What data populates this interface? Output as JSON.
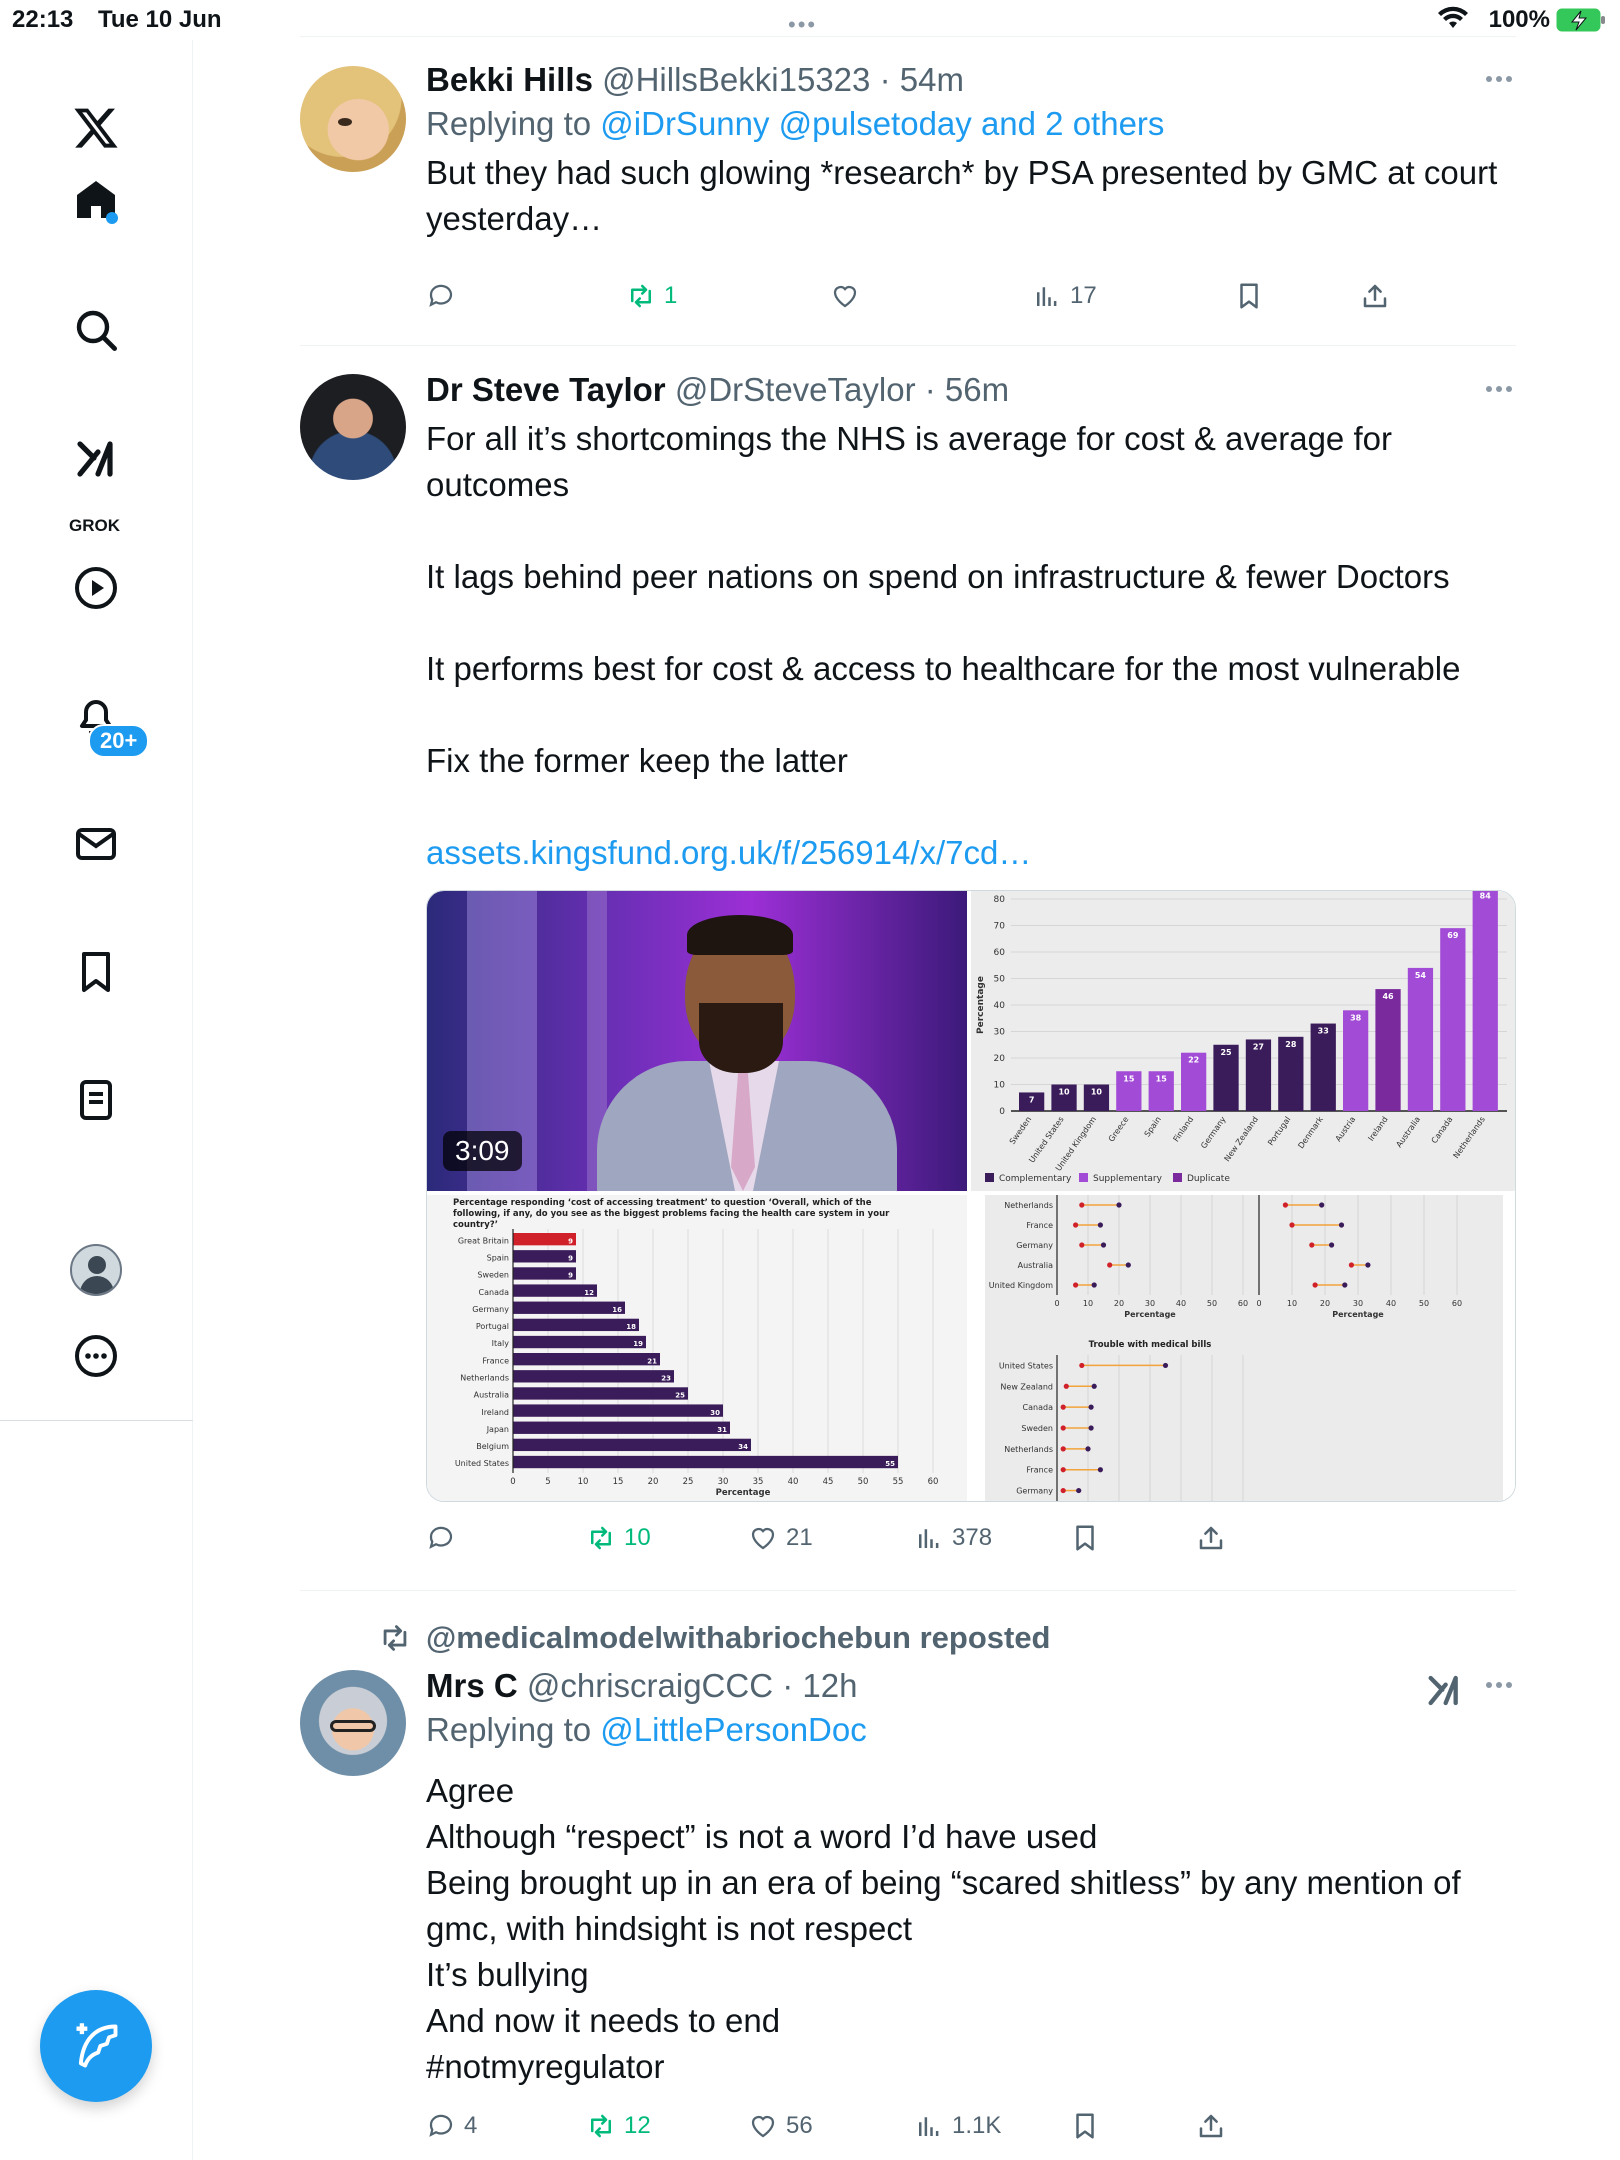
{
  "status_bar": {
    "time": "22:13",
    "date": "Tue 10 Jun",
    "battery": "100%"
  },
  "nav": {
    "notifications_badge": "20+",
    "grok_label": "GROK",
    "items": [
      "x-logo-icon",
      "home-icon",
      "search-icon",
      "grok-icon",
      "video-icon",
      "notifications-icon",
      "messages-icon",
      "bookmarks-icon",
      "lists-icon",
      "profile-icon",
      "more-icon"
    ]
  },
  "tweets": [
    {
      "name": "Bekki Hills",
      "handle": "@HillsBekki15323",
      "time": "54m",
      "reply_prefix": "Replying to",
      "reply_to": "@iDrSunny @pulsetoday and 2 others",
      "text": "But they had such glowing *research* by PSA presented by GMC at court yesterday…",
      "actions": {
        "replies": "",
        "retweets": "1",
        "likes": "",
        "views": "17"
      }
    },
    {
      "name": "Dr Steve Taylor",
      "handle": "@DrSteveTaylor",
      "time": "56m",
      "paragraphs": [
        "For all it’s shortcomings the NHS is average for cost & average for outcomes",
        "It lags behind peer nations on spend on infrastructure & fewer Doctors",
        "It performs best for cost & access to healthcare for the most vulnerable",
        "Fix the former keep the latter"
      ],
      "link": "assets.kingsfund.org.uk/f/256914/x/7cd…",
      "media": {
        "video_duration": "3:09"
      },
      "actions": {
        "replies": "",
        "retweets": "10",
        "likes": "21",
        "views": "378"
      }
    },
    {
      "repost_by": "@medicalmodelwithabriochebun reposted",
      "name": "Mrs C",
      "handle": "@chriscraigCCC",
      "time": "12h",
      "reply_prefix": "Replying to",
      "reply_to": "@LittlePersonDoc",
      "lines": [
        "Agree",
        "Although “respect” is not a word I’d have used",
        "Being brought up in an era of being “scared shitless” by any mention of gmc, with hindsight is not respect",
        "It’s bullying",
        "And now it needs to end"
      ],
      "hashtag": "#notmyregulator",
      "actions": {
        "replies": "4",
        "retweets": "12",
        "likes": "56",
        "views": "1.1K"
      }
    }
  ],
  "chart_data": [
    {
      "type": "bar",
      "ylabel": "Percentage",
      "ylim": [
        0,
        80
      ],
      "categories": [
        "Sweden",
        "United States",
        "United Kingdom",
        "Greece",
        "Spain",
        "Finland",
        "Germany",
        "New Zealand",
        "Portugal",
        "Denmark",
        "Austria",
        "Ireland",
        "Australia",
        "Canada",
        "Netherlands"
      ],
      "values": [
        7,
        10,
        10,
        15,
        15,
        22,
        25,
        27,
        28,
        33,
        38,
        46,
        54,
        69,
        84
      ],
      "kinds": [
        "Complementary",
        "Complementary",
        "Complementary",
        "Supplementary",
        "Supplementary",
        "Supplementary",
        "Complementary",
        "Complementary",
        "Complementary",
        "Complementary",
        "Supplementary",
        "Duplicate",
        "Supplementary",
        "Supplementary",
        "Supplementary"
      ],
      "legend": [
        "Complementary",
        "Supplementary",
        "Duplicate"
      ],
      "colors": {
        "Complementary": "#3b1c5a",
        "Supplementary": "#a24bd6",
        "Duplicate": "#7b2a9e"
      }
    },
    {
      "type": "bar",
      "orientation": "horizontal",
      "title": "Percentage responding ‘cost of accessing treatment’ to question ‘Overall, which of the following, if any, do you see as the biggest problems facing the health care system in your country?’",
      "xlabel": "Percentage",
      "xlim": [
        0,
        60
      ],
      "xticks": [
        0,
        5,
        10,
        15,
        20,
        25,
        30,
        35,
        40,
        45,
        50,
        55,
        60
      ],
      "categories": [
        "Great Britain",
        "Spain",
        "Sweden",
        "Canada",
        "Germany",
        "Portugal",
        "Italy",
        "France",
        "Netherlands",
        "Australia",
        "Ireland",
        "Japan",
        "Belgium",
        "United States"
      ],
      "values": [
        9,
        9,
        9,
        12,
        16,
        18,
        19,
        21,
        23,
        25,
        30,
        31,
        34,
        55
      ],
      "highlight": "Great Britain",
      "colors": {
        "highlight": "#d0202a",
        "default": "#3b1c5a"
      }
    },
    {
      "type": "scatter",
      "panels": [
        {
          "categories": [
            "Netherlands",
            "France",
            "Germany",
            "Australia",
            "United Kingdom"
          ],
          "low": [
            8,
            6,
            8,
            17,
            6
          ],
          "high": [
            20,
            14,
            15,
            23,
            12
          ],
          "xlabel": "Percentage",
          "xticks": [
            0,
            10,
            20,
            30,
            40,
            50,
            60
          ]
        },
        {
          "categories": [
            "Netherlands",
            "France",
            "Germany",
            "Australia",
            "United Kingdom"
          ],
          "low": [
            8,
            10,
            16,
            28,
            17
          ],
          "high": [
            19,
            25,
            22,
            33,
            26
          ],
          "xlabel": "Percentage",
          "xticks": [
            0,
            10,
            20,
            30,
            40,
            50,
            60
          ]
        },
        {
          "title": "Trouble with medical bills",
          "categories": [
            "United States",
            "New Zealand",
            "Canada",
            "Sweden",
            "Netherlands",
            "France",
            "Germany"
          ],
          "low": [
            8,
            3,
            2,
            2,
            2,
            2,
            2
          ],
          "high": [
            35,
            12,
            11,
            11,
            10,
            14,
            7
          ]
        }
      ],
      "colors": {
        "low": "#d0202a",
        "high": "#3b1c5a",
        "range": "#f2a33a"
      }
    }
  ]
}
